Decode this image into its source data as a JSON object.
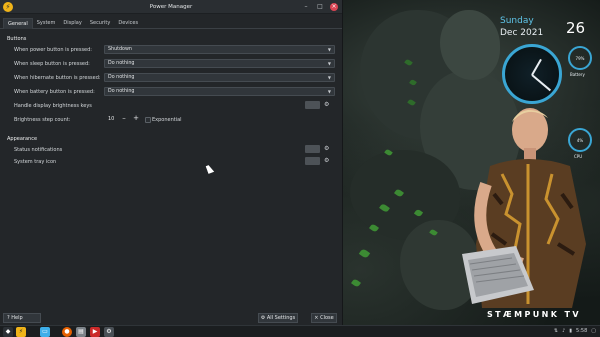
{
  "window": {
    "title": "Power Manager",
    "controls": {
      "minimize": "–",
      "maximize": "□",
      "close": "×"
    }
  },
  "tabs": [
    "General",
    "System",
    "Display",
    "Security",
    "Devices"
  ],
  "buttons_section": {
    "title": "Buttons",
    "rows": [
      {
        "label": "When power button is pressed:",
        "value": "Shutdown"
      },
      {
        "label": "When sleep button is pressed:",
        "value": "Do nothing"
      },
      {
        "label": "When hibernate button is pressed:",
        "value": "Do nothing"
      },
      {
        "label": "When battery button is pressed:",
        "value": "Do nothing"
      }
    ],
    "brightness_keys_label": "Handle display brightness keys",
    "brightness_step_label": "Brightness step count:",
    "brightness_step_value": "10",
    "minus": "–",
    "plus": "+",
    "exponential_label": "Exponential"
  },
  "appearance_section": {
    "title": "Appearance",
    "status_notifications_label": "Status notifications",
    "system_tray_icon_label": "System tray icon"
  },
  "bottom": {
    "help": "Help",
    "all_settings": "All Settings",
    "close": "Close"
  },
  "conky": {
    "day": "Sunday",
    "month_year": "Dec 2021",
    "date": "26",
    "battery_percent": "79%",
    "battery_label": "Battery",
    "cpu_percent": "4%",
    "cpu_label": "CPU"
  },
  "watermark": "STÆMPUNK TV",
  "taskbar": {
    "clock": "5:58"
  },
  "icons": {
    "app": "power-manager-icon",
    "gear": "gear-icon",
    "help": "help-icon",
    "settings": "settings-icon",
    "close": "close-icon"
  },
  "colors": {
    "window_bg": "#232629",
    "accent": "#3aa6d4",
    "close_red": "#da4453",
    "app_icon": "#f0b419"
  }
}
